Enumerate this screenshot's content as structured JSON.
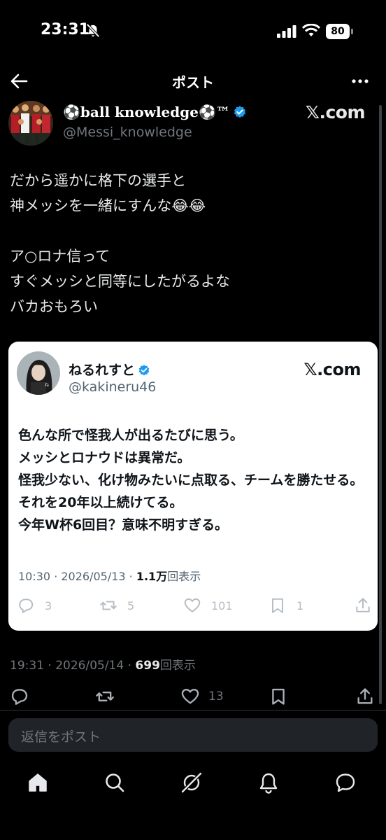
{
  "status_bar": {
    "time": "23:31",
    "battery": "80"
  },
  "nav": {
    "title": "ポスト"
  },
  "post": {
    "display_name": "⚽ball knowledge⚽™",
    "handle": "@Messi_knowledge",
    "source": "𝕏.com",
    "body": "だから遥かに格下の選手と\n神メッシを一緒にすんな😂😂\n\nア○ロナ信って\nすぐメッシと同等にしたがるよな\nバカおもろい",
    "meta_time": "19:31 · 2026/05/14 · ",
    "meta_views_count": "699",
    "meta_views_label": "回表示",
    "likes": "13"
  },
  "quote": {
    "display_name": "ねるれすと",
    "handle": "@kakineru46",
    "source": "𝕏.com",
    "body": "色んな所で怪我人が出るたびに思う。\nメッシとロナウドは異常だ。\n怪我少ない、化け物みたいに点取る、チームを勝たせる。それを20年以上続けてる。\n今年W杯6回目？意味不明すぎる。",
    "meta_time": "10:30 · 2026/05/13 · ",
    "meta_views_count": "1.1万",
    "meta_views_label": "回表示",
    "replies": "3",
    "reposts": "5",
    "likes": "101",
    "bookmarks": "1"
  },
  "reply": {
    "placeholder": "返信をポスト"
  },
  "icons": {
    "back": "arrow-left-icon",
    "more": "more-horizontal-icon",
    "verified": "verified-badge-icon",
    "reply": "reply-icon",
    "repost": "repost-icon",
    "like": "heart-icon",
    "bookmark": "bookmark-icon",
    "share": "share-icon",
    "tabs": [
      "home-icon",
      "search-icon",
      "grok-icon",
      "notifications-icon",
      "messages-icon"
    ]
  },
  "colors": {
    "background": "#000000",
    "verified": "#1d9bf0",
    "muted": "#71767b",
    "card": "#ffffff"
  }
}
